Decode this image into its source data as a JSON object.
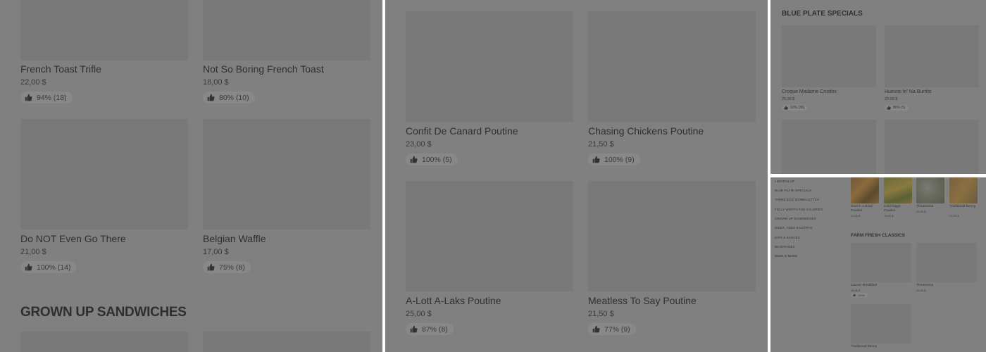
{
  "panel1": {
    "items": [
      {
        "name": "French Toast Trifle",
        "price": "22,00 $",
        "rating": "94% (18)"
      },
      {
        "name": "Not So Boring French Toast",
        "price": "18,00 $",
        "rating": "80% (10)"
      },
      {
        "name": "Do NOT Even Go There",
        "price": "21,00 $",
        "rating": "100% (14)"
      },
      {
        "name": "Belgian Waffle",
        "price": "17,00 $",
        "rating": "75% (8)"
      }
    ],
    "section_title": "GROWN UP SANDWICHES"
  },
  "panel2": {
    "items": [
      {
        "name": "Confit De Canard Poutine",
        "price": "23,00 $",
        "rating": "100% (5)"
      },
      {
        "name": "Chasing Chickens Poutine",
        "price": "21,50 $",
        "rating": "100% (9)"
      },
      {
        "name": "A-Lott A-Laks Poutine",
        "price": "25,00 $",
        "rating": "87% (8)"
      },
      {
        "name": "Meatless To Say Poutine",
        "price": "21,50 $",
        "rating": "77% (9)"
      }
    ]
  },
  "panel3": {
    "section_title": "BLUE PLATE SPECIALS",
    "items": [
      {
        "name": "Croque Madame Crostini",
        "price": "25,00 $",
        "rating": "92% (36)"
      },
      {
        "name": "Huevos In' Na Burrito",
        "price": "20,00 $",
        "rating": "80% (5)"
      }
    ]
  },
  "panel4": {
    "categories": [
      "LIGHTEN UP",
      "BLUE PLATE SPECIALS",
      "THREE EGG BOMBALETTES",
      "FULLY WORTH THE CALORIES",
      "GROWN UP SANDWICHES",
      "SIDES, ADDS & EXTRAS",
      "DIPS & SAUCES",
      "BEVERAGES",
      "BEER & MORE"
    ],
    "top_items": [
      {
        "name": "Soul In A Bowl Poutine",
        "price": "21,00 $"
      },
      {
        "name": "Cold Diggs Poutine",
        "price": "19,00 $"
      },
      {
        "name": "Threesome",
        "price": "20,00 $"
      },
      {
        "name": "Traditional Benny",
        "price": "21,00 $"
      }
    ],
    "section_title": "FARM FRESH CLASSICS",
    "items": [
      {
        "name": "Classic Breakfast",
        "price": "16,00 $",
        "rating": "100%"
      },
      {
        "name": "Threesome",
        "price": "20,00 $"
      },
      {
        "name": "Traditional Benny",
        "price": ""
      }
    ]
  },
  "icons": {
    "thumb": "thumbs-up-icon"
  },
  "colors": {
    "overlay": "#808080",
    "image_placeholder": "#797979",
    "pill": "#888888"
  }
}
